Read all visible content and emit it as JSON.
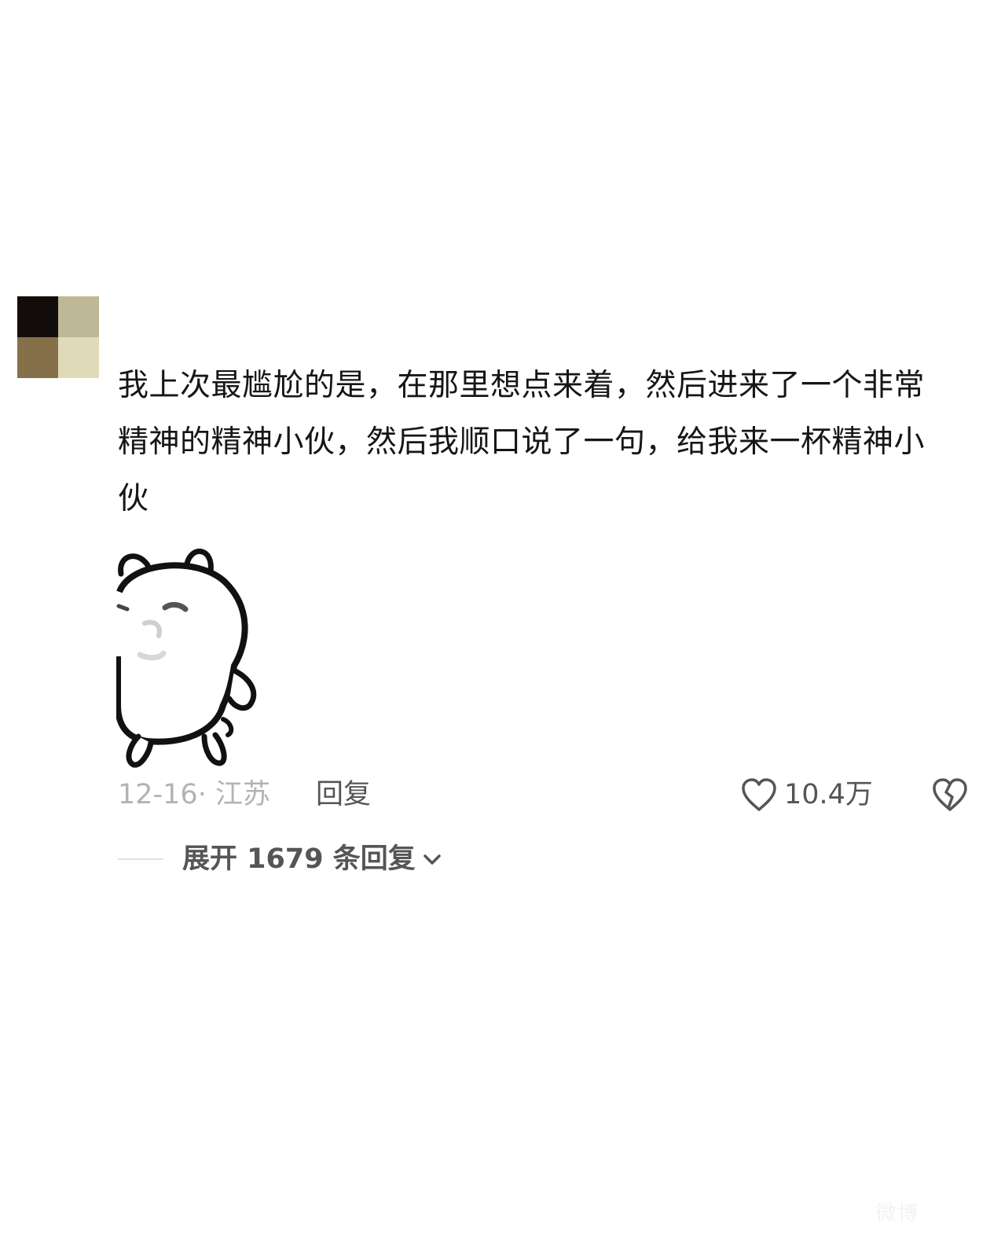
{
  "comment": {
    "avatar_colors": [
      "#120d0a",
      "#bfb896",
      "#85704a",
      "#e0dab9"
    ],
    "text": "我上次最尴尬的是，在那里想点来着，然后进来了一个非常精神的精神小伙，然后我顺口说了一句，给我来一杯精神小伙",
    "sticker_icon": "white-bear-sticker",
    "date_location": "12-16· 江苏",
    "reply_label": "回复",
    "like_icon": "heart-outline-icon",
    "like_count": "10.4万",
    "dislike_icon": "broken-heart-icon"
  },
  "replies": {
    "expand_label": "展开 1679 条回复",
    "chevron_icon": "chevron-down-icon"
  },
  "watermark": {
    "text": "微博"
  }
}
